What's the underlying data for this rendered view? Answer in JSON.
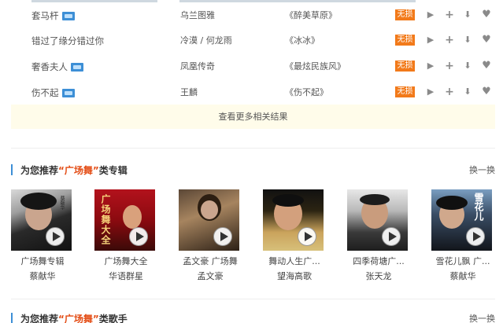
{
  "songs": [
    {
      "title": "套马杆",
      "mv": true,
      "artist": "乌兰图雅",
      "album": "《醉美草原》",
      "badge": "无损"
    },
    {
      "title": "错过了缘分错过你",
      "mv": false,
      "artist": "冷漠 / 何龙雨",
      "album": "《冰冰》",
      "badge": "无损"
    },
    {
      "title": "奢香夫人",
      "mv": true,
      "artist": "凤凰传奇",
      "album": "《最炫民族风》",
      "badge": "无损"
    },
    {
      "title": "伤不起",
      "mv": true,
      "artist": "王麟",
      "album": "《伤不起》",
      "badge": "无损"
    }
  ],
  "more_results": "查看更多相关结果",
  "album_section": {
    "prefix": "为您推荐",
    "keyword": "“广场舞”",
    "suffix": "类专辑",
    "change": "换一换"
  },
  "albums": [
    {
      "title": "广场舞专辑",
      "artist": "蔡献华"
    },
    {
      "title": "广场舞大全",
      "artist": "华语群星"
    },
    {
      "title": "孟文豪 广场舞",
      "artist": "孟文豪"
    },
    {
      "title": "舞动人生广...",
      "artist": "望海高歌"
    },
    {
      "title": "四季荷塘广...",
      "artist": "张天龙"
    },
    {
      "title": "雪花儿飘 广...",
      "artist": "蔡献华"
    }
  ],
  "album_cover_text": {
    "a1": "蔡献华",
    "a2": "广场舞大全",
    "a6": "雪花儿"
  },
  "singer_section": {
    "prefix": "为您推荐",
    "keyword": "“广场舞”",
    "suffix": "类歌手",
    "change": "换一换"
  },
  "colors": {
    "accent": "#3d8fd6",
    "lossless_badge": "#f27a1a",
    "keyword": "#e34a12",
    "more_bar_bg": "#fffcea"
  },
  "icons": {
    "play": "play-icon",
    "add": "add-icon",
    "download": "download-icon",
    "favorite": "heart-icon",
    "mv": "mv-icon"
  }
}
